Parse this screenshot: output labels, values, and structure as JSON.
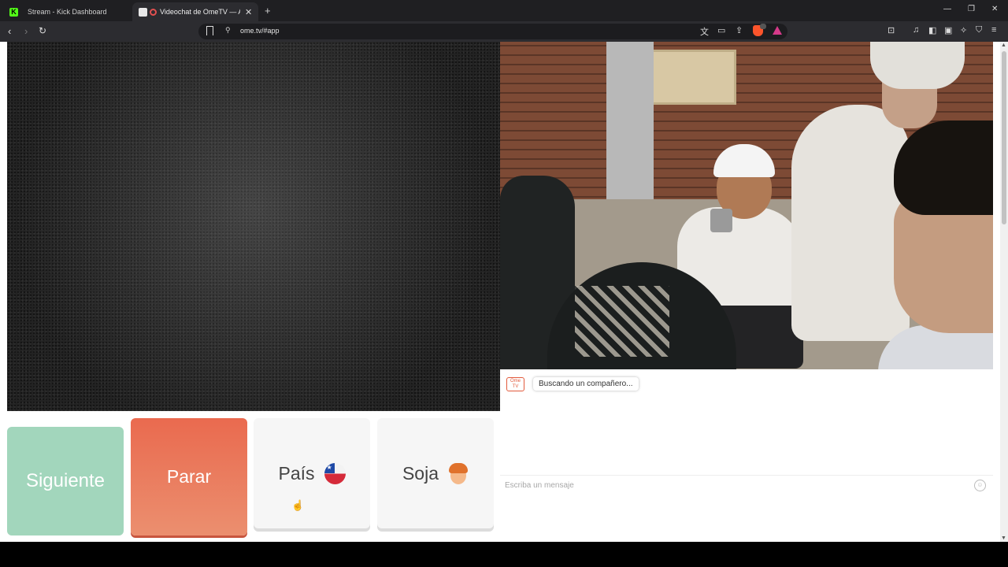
{
  "browser": {
    "tabs": [
      {
        "label": "Stream - Kick Dashboard",
        "icon": "kick-icon"
      },
      {
        "label": "Videochat de OmeTV — Alte",
        "icon": "ometv-icon",
        "active": true
      }
    ],
    "new_tab": "+",
    "url": "ome.tv/#app",
    "window_controls": {
      "minimize": "—",
      "restore": "❐",
      "close": "✕"
    }
  },
  "page": {
    "buttons": {
      "next_label": "Siguiente",
      "stop_label": "Parar",
      "country_label": "País",
      "country_flag": "chile-flag-icon",
      "gender_label": "Soja",
      "gender_icon": "boy-icon"
    },
    "chat": {
      "logo_text": "Ome TV",
      "status_message": "Buscando un compañero...",
      "input_placeholder": "Escriba un mensaje"
    }
  },
  "colors": {
    "next_button": "#a2d6bc",
    "stop_button": "#ea6a4f",
    "neutral_button": "#f6f6f6"
  }
}
